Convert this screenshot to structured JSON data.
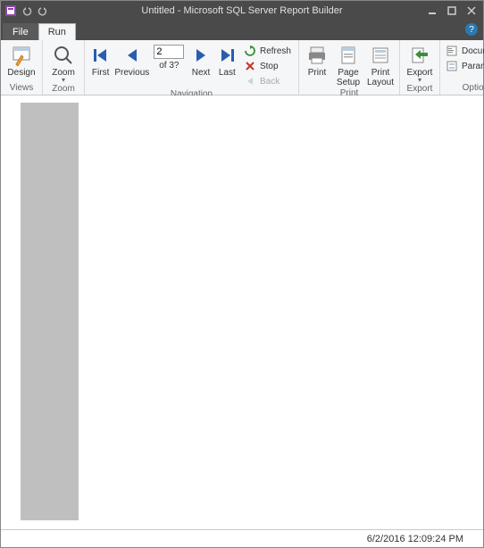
{
  "window": {
    "title": "Untitled - Microsoft SQL Server Report Builder"
  },
  "tabs": {
    "file": "File",
    "run": "Run"
  },
  "ribbon": {
    "views": {
      "design": "Design",
      "group": "Views"
    },
    "zoom": {
      "zoom": "Zoom",
      "group": "Zoom"
    },
    "navigation": {
      "first": "First",
      "previous": "Previous",
      "next": "Next",
      "last": "Last",
      "page_value": "2",
      "page_of": "of 3?",
      "refresh": "Refresh",
      "stop": "Stop",
      "back": "Back",
      "group": "Navigation"
    },
    "print": {
      "print": "Print",
      "page_setup_l1": "Page",
      "page_setup_l2": "Setup",
      "print_layout_l1": "Print",
      "print_layout_l2": "Layout",
      "group": "Print"
    },
    "export": {
      "export": "Export",
      "group": "Export"
    },
    "options": {
      "document": "Document",
      "parameters": "Parameters",
      "group": "Options"
    }
  },
  "status": {
    "datetime": "6/2/2016 12:09:24 PM"
  }
}
